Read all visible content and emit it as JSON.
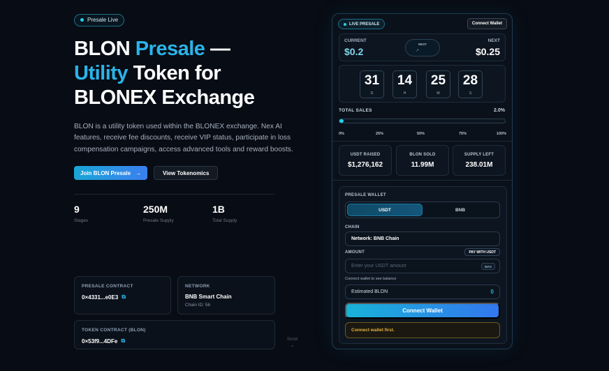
{
  "hero": {
    "badge": "Presale Live",
    "title_1": "BLON ",
    "title_2": "Presale",
    "title_3": " —",
    "title_4": "Utility",
    "title_5": " Token for",
    "title_6": "BLONEX Exchange",
    "description": "BLON is a utility token used within the BLONEX exchange. Nex AI features, receive fee discounts, receive VIP status, participate in loss compensation campaigns, access advanced tools and reward boosts.",
    "primary_cta": "Join BLON Presale",
    "primary_cta_icon": "→",
    "secondary_cta": "View Tokenomics"
  },
  "stats": [
    {
      "value": "9",
      "label": "Stages"
    },
    {
      "value": "250M",
      "label": "Presale Supply"
    },
    {
      "value": "1B",
      "label": "Total Supply"
    }
  ],
  "cards": {
    "presale_contract": {
      "title": "PRESALE CONTRACT",
      "value": "0×4331...e0E3"
    },
    "network": {
      "title": "NETWORK",
      "value": "BNB Smart Chain",
      "sub": "Chain ID: 56"
    },
    "token_contract": {
      "title": "TOKEN CONTRACT (BLON)",
      "value": "0×53f9...4DFe"
    }
  },
  "scroll": {
    "label": "Scroll",
    "icon": "⌄"
  },
  "panel": {
    "badge": "LIVE PRESALE",
    "connect_top": "Connect Wallet",
    "current_label": "CURRENT",
    "current_value": "$0.2",
    "next_pill_label": "NEXT",
    "next_pill_arrow": "↗",
    "next_label": "NEXT",
    "next_value": "$0.25",
    "countdown": [
      {
        "value": "31",
        "unit": "D"
      },
      {
        "value": "14",
        "unit": "H"
      },
      {
        "value": "25",
        "unit": "M"
      },
      {
        "value": "28",
        "unit": "S"
      }
    ],
    "total_sales_label": "TOTAL SALES",
    "total_sales_pct": "2.0%",
    "progress_fraction": 0.02,
    "ticks": [
      "0%",
      "25%",
      "50%",
      "75%",
      "100%"
    ],
    "metrics": [
      {
        "title": "USDT RAISED",
        "value": "$1,276,162"
      },
      {
        "title": "BLON SOLD",
        "value": "11.99M"
      },
      {
        "title": "SUPPLY LEFT",
        "value": "238.01M"
      }
    ],
    "wallet": {
      "title": "PRESALE WALLET",
      "tab_active": "USDT",
      "tab_inactive": "BNB",
      "chain_label": "CHAIN",
      "chain_value": "Network: BNB Chain",
      "amount_label": "AMOUNT",
      "pay_with": "PAY WITH USDT",
      "amount_placeholder": "Enter your USDT amount",
      "max": "MAX",
      "hint": "Connect wallet to see balance",
      "estimated_label": "Estimated BLON",
      "estimated_value": "0",
      "connect_button": "Connect Wallet",
      "warning": "Connect wallet first."
    }
  },
  "colors": {
    "accent": "#22d3ee",
    "gradient_start": "#1aa6d6",
    "gradient_end": "#3b7ff0",
    "warning": "#e3b341"
  }
}
